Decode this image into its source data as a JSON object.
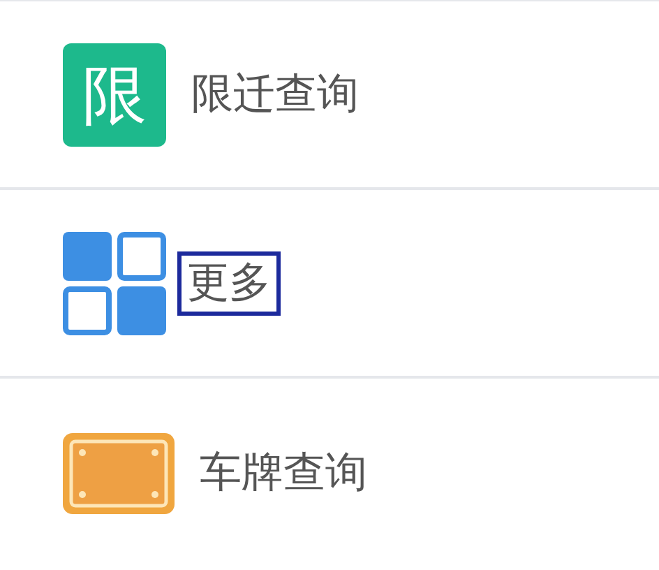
{
  "menu": {
    "items": [
      {
        "kind": "badge",
        "badge": "限",
        "label": "限迁查询",
        "highlighted": false
      },
      {
        "kind": "grid",
        "label": "更多",
        "highlighted": true
      },
      {
        "kind": "plate",
        "label": "车牌查询",
        "highlighted": false
      }
    ]
  }
}
